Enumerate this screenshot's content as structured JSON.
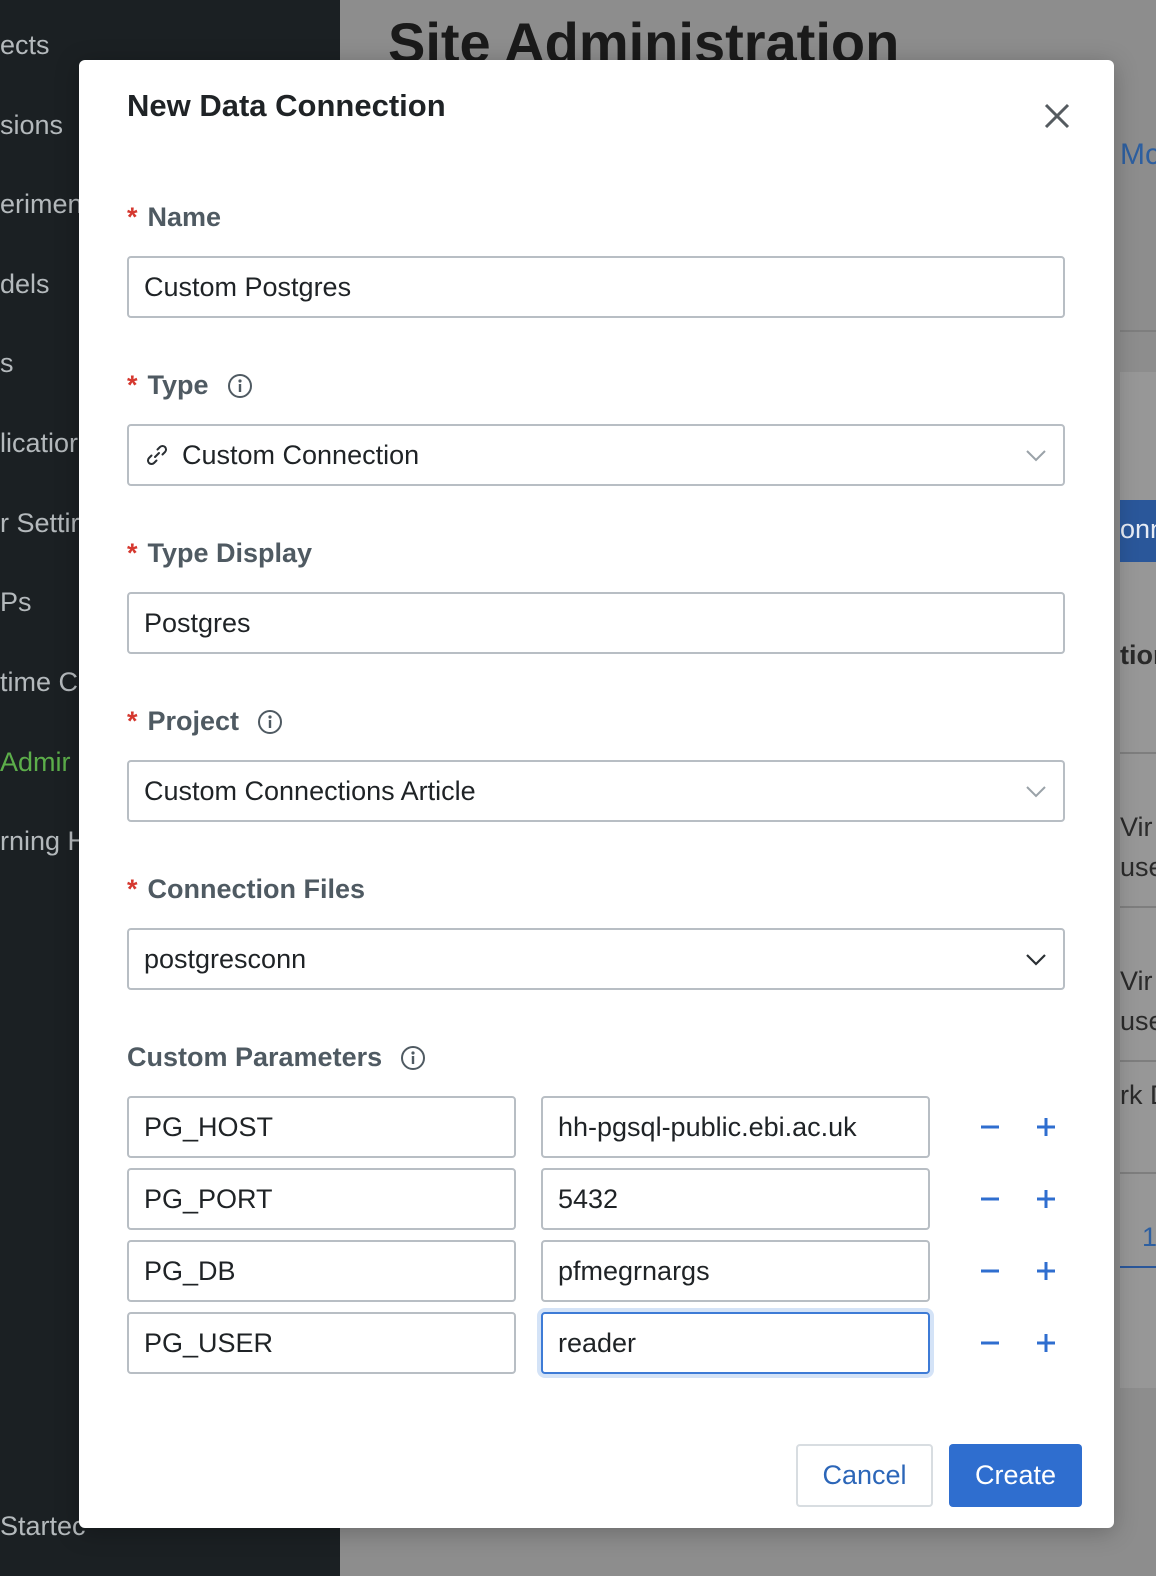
{
  "background": {
    "sidebar_items": [
      {
        "label": "ects",
        "active": false
      },
      {
        "label": "sions",
        "active": false
      },
      {
        "label": "erimen",
        "active": false
      },
      {
        "label": "dels",
        "active": false
      },
      {
        "label": "s",
        "active": false
      },
      {
        "label": "licatior",
        "active": false
      },
      {
        "label": "r Settir",
        "active": false
      },
      {
        "label": "Ps",
        "active": false
      },
      {
        "label": "time C",
        "active": false
      },
      {
        "label": "Admir",
        "active": true
      },
      {
        "label": "rning H",
        "active": false
      }
    ],
    "sidebar_footer": "Startec",
    "page_title": "Site Administration",
    "right_fragments": {
      "tab_link": "Mc",
      "button_text": "onn",
      "heading": "tior",
      "row1_a": "Vir",
      "row1_b": "use",
      "row2_a": "Vir",
      "row2_b": "use",
      "row3": "rk D",
      "pager": "1"
    }
  },
  "modal": {
    "title": "New Data Connection",
    "close_icon": "close-icon",
    "fields": {
      "name": {
        "label": "Name",
        "required": true,
        "value": "Custom Postgres"
      },
      "type": {
        "label": "Type",
        "required": true,
        "value": "Custom Connection",
        "icon": "link-icon"
      },
      "type_display": {
        "label": "Type Display",
        "required": true,
        "value": "Postgres"
      },
      "project": {
        "label": "Project",
        "required": true,
        "value": "Custom Connections Article"
      },
      "connection_files": {
        "label": "Connection Files",
        "required": true,
        "value": "postgresconn"
      }
    },
    "custom_parameters": {
      "label": "Custom Parameters",
      "rows": [
        {
          "key": "PG_HOST",
          "value": "hh-pgsql-public.ebi.ac.uk"
        },
        {
          "key": "PG_PORT",
          "value": "5432"
        },
        {
          "key": "PG_DB",
          "value": "pfmegrnargs"
        },
        {
          "key": "PG_USER",
          "value": "reader"
        }
      ]
    },
    "buttons": {
      "cancel": "Cancel",
      "create": "Create"
    },
    "colors": {
      "accent": "#2f6ecf",
      "required": "#d5382f",
      "active_nav": "#5cae4a"
    }
  }
}
